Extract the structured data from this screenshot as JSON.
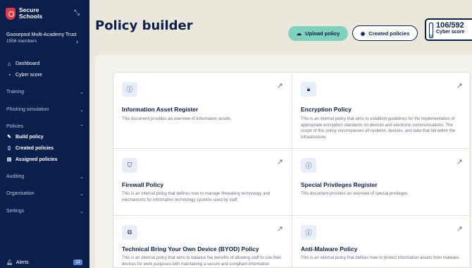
{
  "brand": {
    "line1": "Secure",
    "line2": "Schools"
  },
  "org": {
    "name": "Goosepool Multi-Academy Trust",
    "members": "1556 members"
  },
  "nav": {
    "dashboard": "Dashboard",
    "cyber_score": "Cyber score"
  },
  "sections": {
    "training": "Training",
    "phishing": "Phishing simulation",
    "policies": "Policies",
    "auditing": "Auditing",
    "organisation": "Organisation",
    "settings": "Settings"
  },
  "policies_sub": {
    "build": "Build policy",
    "created": "Created policies",
    "assigned": "Assigned policies"
  },
  "alerts": {
    "label": "Alerts",
    "count": "12"
  },
  "header": {
    "title": "Policy builder",
    "upload_label": "Upload policy",
    "created_label": "Created policies"
  },
  "score": {
    "value": "106/592",
    "label": "Cyber score",
    "fill_fraction": 0.18
  },
  "cards": [
    {
      "title": "Information Asset Register",
      "desc": "This document provides an overview of information assets.",
      "icon": "info-icon"
    },
    {
      "title": "Encryption Policy",
      "desc": "This is an internal policy that aims to establish guidelines for the implementation of appropriate encryption standards on devices and electronic communications. The scope of this policy encompasses all systems, devices, and data that fall within the infrastructure.",
      "icon": "lock-icon"
    },
    {
      "title": "Firewall Policy",
      "desc": "This is an internal policy that defines how to manage firewalling technology and mechanisms for information technology systems used by staff.",
      "icon": "shield-icon"
    },
    {
      "title": "Special Privileges Register",
      "desc": "This document provides an overview of special privileges.",
      "icon": "info-icon"
    },
    {
      "title": "Technical Bring Your Own Device (BYOD) Policy",
      "desc": "This is an internal policy that aims to balance the benefits of allowing staff to use their devices for work purposes with maintaining a secure and compliant information technology environment.",
      "icon": "devices-icon"
    },
    {
      "title": "Anti-Malware Policy",
      "desc": "This is an internal policy that defines how to protect information assets from malware.",
      "icon": "info-icon"
    }
  ]
}
